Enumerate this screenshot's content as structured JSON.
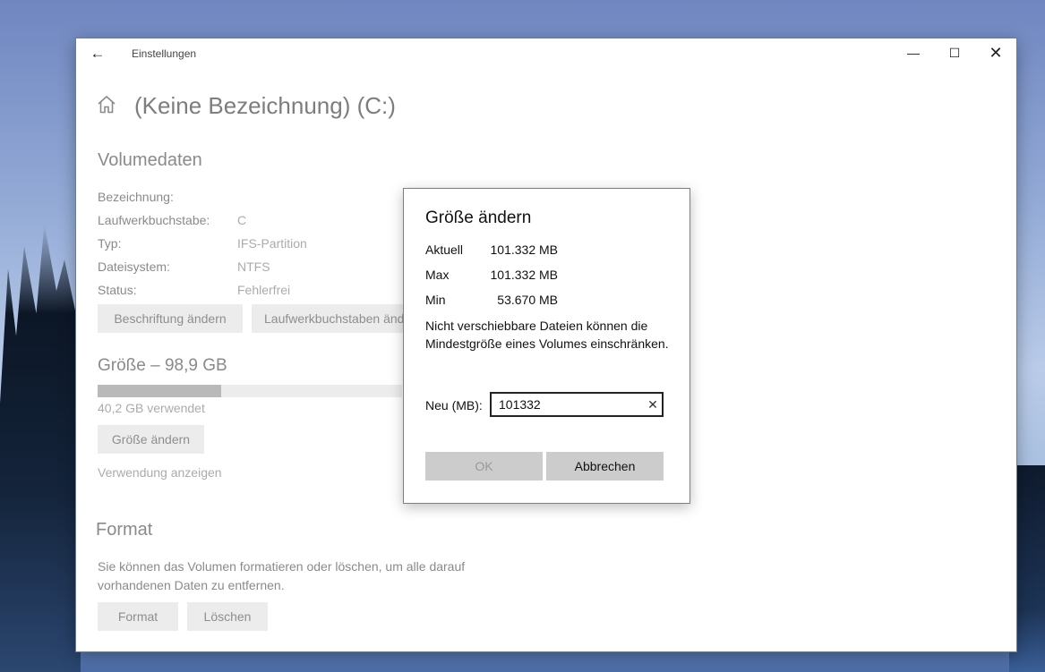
{
  "window": {
    "title": "Einstellungen",
    "back_icon": "←",
    "minimize_icon": "—",
    "maximize_icon": "☐",
    "close_icon": "✕"
  },
  "header": {
    "title": "(Keine Bezeichnung) (C:)",
    "home_icon": "home-icon"
  },
  "volume": {
    "section_title": "Volumedaten",
    "rows": [
      {
        "label": "Bezeichnung:",
        "value": ""
      },
      {
        "label": "Laufwerkbuchstabe:",
        "value": "C"
      },
      {
        "label": "Typ:",
        "value": "IFS-Partition"
      },
      {
        "label": "Dateisystem:",
        "value": "NTFS"
      },
      {
        "label": "Status:",
        "value": "Fehlerfrei"
      }
    ],
    "btn_label": "Beschriftung ändern",
    "btn_letter": "Laufwerkbuchstaben ändern"
  },
  "size": {
    "section_title": "Größe – 98,9 GB",
    "used_fraction": 0.407,
    "used_text": "40,2 GB verwendet",
    "btn_resize": "Größe ändern",
    "link_usage": "Verwendung anzeigen"
  },
  "format": {
    "section_title": "Format",
    "description": "Sie können das Volumen formatieren oder löschen, um alle darauf vorhandenen Daten zu entfernen.",
    "btn_format": "Format",
    "btn_delete": "Löschen"
  },
  "dialog": {
    "title": "Größe ändern",
    "current_label": "Aktuell",
    "current_value": "101.332 MB",
    "max_label": "Max",
    "max_value": "101.332 MB",
    "min_label": "Min",
    "min_value": "53.670 MB",
    "note": "Nicht verschiebbare Dateien können die Mindestgröße eines Volumes einschränken.",
    "new_label": "Neu (MB):",
    "new_value": "101332",
    "clear_icon": "✕",
    "ok_label": "OK",
    "cancel_label": "Abbrechen"
  },
  "colors": {
    "accent_disabled": "#cccccc",
    "bar_fill": "#b9b9b9",
    "bar_track": "#ececec"
  }
}
